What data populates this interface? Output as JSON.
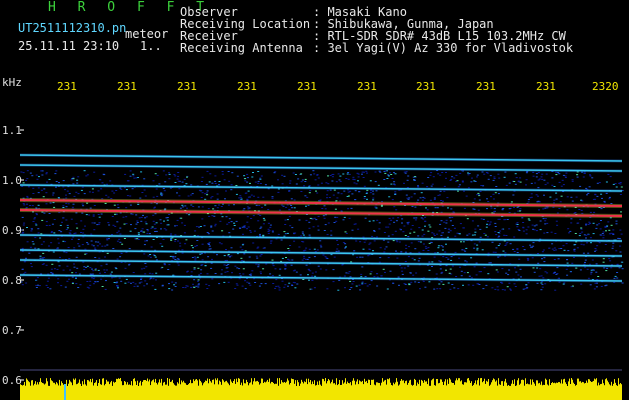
{
  "app": {
    "name": "H R O F F T",
    "file_name": "UT2511112310.pn",
    "mode_label": "meteor",
    "timestamp": "25.11.11 23:10",
    "extra": "1.."
  },
  "info": [
    {
      "label": "Observer",
      "value": ": Masaki Kano"
    },
    {
      "label": "Receiving Location",
      "value": ": Shibukawa, Gunma, Japan"
    },
    {
      "label": "Receiver",
      "value": ": RTL-SDR SDR# 43dB L15 103.2MHz CW"
    },
    {
      "label": "Receiving Antenna",
      "value": ": 3el Yagi(V) Az 330 for Vladivostok"
    }
  ],
  "axis": {
    "y_unit": "kHz",
    "y_ticks": [
      "1.1",
      "1.0",
      "0.9",
      "0.8",
      "0.7",
      "0.6"
    ],
    "x_ticks": [
      "231",
      "231",
      "231",
      "231",
      "231",
      "231",
      "231",
      "231",
      "231",
      "2320"
    ]
  },
  "colors": {
    "title": "#3cd13c",
    "filename": "#5fd7ff",
    "tick_y": "#e0e0e0",
    "tick_x": "#f2e600",
    "spectrum_bg": "#000000"
  },
  "chart_data": {
    "type": "heatmap",
    "y_unit": "kHz",
    "y_range": [
      0.6,
      1.15
    ],
    "lines_khz": [
      1.05,
      1.03,
      0.99,
      0.96,
      0.94,
      0.89,
      0.86,
      0.84,
      0.81
    ],
    "band_khz": [
      0.78,
      1.02
    ]
  }
}
